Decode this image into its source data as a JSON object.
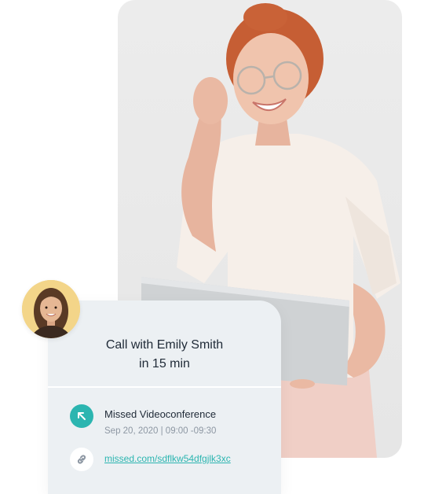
{
  "photo": {
    "subject": "woman-with-laptop-photo"
  },
  "avatar": {
    "subject": "caller-avatar"
  },
  "notification": {
    "title_line1": "Call with Emily Smith",
    "title_line2": "in 15 min",
    "event_title": "Missed Videoconference",
    "event_time": "Sep 20, 2020 | 09:00 -09:30",
    "link_text": "missed.com/sdflkw54dfgjlk3xc"
  },
  "colors": {
    "accent": "#2bb5b0",
    "card_bg": "#ecf0f3",
    "avatar_bg": "#f3d589"
  },
  "icons": {
    "missed": "missed-call-arrow-icon",
    "link": "link-icon"
  }
}
